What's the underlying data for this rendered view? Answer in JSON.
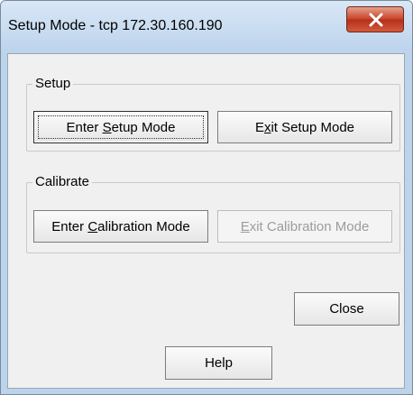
{
  "window": {
    "title": "Setup Mode - tcp 172.30.160.190"
  },
  "setup_group": {
    "label": "Setup",
    "enter_button": {
      "pre": "Enter ",
      "accel": "S",
      "post": "etup Mode"
    },
    "exit_button": {
      "pre": "E",
      "accel": "x",
      "post": "it Setup Mode"
    }
  },
  "calibrate_group": {
    "label": "Calibrate",
    "enter_button": {
      "pre": "Enter ",
      "accel": "C",
      "post": "alibration Mode"
    },
    "exit_button": {
      "pre": "",
      "accel": "E",
      "post": "xit Calibration Mode",
      "disabled": true
    }
  },
  "close_button": {
    "label": "Close"
  },
  "help_button": {
    "label": "Help"
  },
  "colors": {
    "close_x": "#c8462c",
    "title_bar": "#bcd3ec",
    "dialog_bg": "#f0f0f0"
  }
}
